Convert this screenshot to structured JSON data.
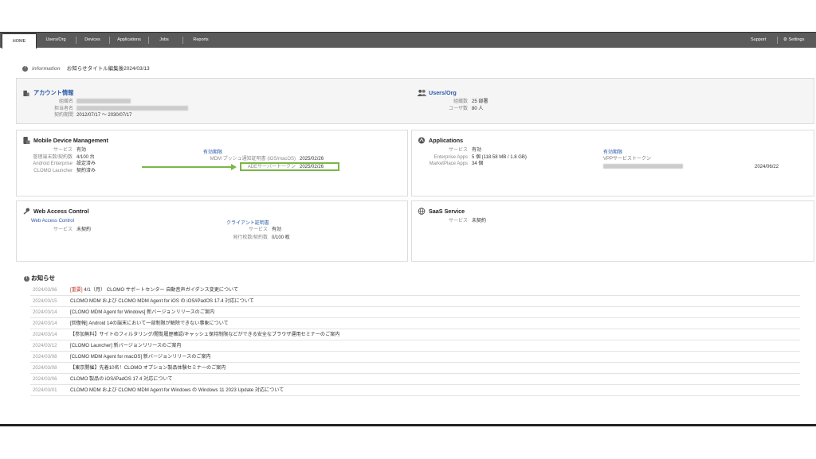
{
  "nav": {
    "tabs": [
      "HOME",
      "Users/Org",
      "Devices",
      "Applications",
      "Jobs",
      "Reports"
    ],
    "active": "HOME",
    "support": "Support",
    "settings": "Settings"
  },
  "info": {
    "title": "information",
    "text": "お知らせタイトル編集後2024/03/13"
  },
  "account": {
    "title": "アカウント情報",
    "labels": [
      "組織名",
      "担当者名",
      "契約期間"
    ],
    "period": "2012/07/17 〜 2030/07/17"
  },
  "users_org": {
    "title": "Users/Org",
    "labels": [
      "組織数",
      "ユーザ数"
    ],
    "values": [
      "25 部署",
      "80 人"
    ]
  },
  "mdm": {
    "title": "Mobile Device Management",
    "labels": [
      "サービス",
      "管理端末数/契約数",
      "Android Enterprise",
      "CLOMO Launcher"
    ],
    "values": [
      "有効",
      "4/100 台",
      "設定済み",
      "契約済み"
    ],
    "expiry_title": "有効期限",
    "cert_label": "MDM プッシュ通知証明書 (iOS/macOS)",
    "cert_date": "2025/02/26",
    "ade_label": "ADEサーバートークン",
    "ade_date": "2025/02/26"
  },
  "apps": {
    "title": "Applications",
    "labels": [
      "サービス",
      "Enterprise Apps",
      "MarketPlace Apps"
    ],
    "values": [
      "有効",
      "5 個 (118.58 MB / 1.8 GB)",
      "34 個"
    ],
    "expiry_title": "有効期限",
    "vpp_label": "VPPサービストークン",
    "vpp_date": "2024/06/22"
  },
  "wac": {
    "title": "Web Access Control",
    "link": "Web Access Control",
    "labels": [
      "サービス"
    ],
    "values": [
      "未契約"
    ],
    "cert_title": "クライアント証明書",
    "cert_labels": [
      "サービス",
      "発行枚数/契約数"
    ],
    "cert_values": [
      "有効",
      "0/100 枚"
    ]
  },
  "saas": {
    "title": "SaaS Service",
    "labels": [
      "サービス"
    ],
    "values": [
      "未契約"
    ]
  },
  "news": {
    "title": "お知らせ",
    "items": [
      {
        "date": "2024/03/06",
        "tag": "[重要]",
        "text": "4/1（月） CLOMO サポートセンター 自動音声ガイダンス変更について"
      },
      {
        "date": "2024/03/15",
        "tag": "",
        "text": "CLOMO MDM および CLOMO MDM Agent for iOS の iOS/iPadOS 17.4 対応について"
      },
      {
        "date": "2024/03/14",
        "tag": "",
        "text": "[CLOMO MDM Agent for Windows] 新バージョンリリースのご案内"
      },
      {
        "date": "2024/03/14",
        "tag": "",
        "text": "[回復報] Android 14の端末において一部制限が解除できない事象について"
      },
      {
        "date": "2024/03/14",
        "tag": "",
        "text": "【参加無料】サイトのフィルタリング/閲覧履歴確認/キャッシュ保持制限などができる安全なブラウザ運用セミナーのご案内"
      },
      {
        "date": "2024/03/12",
        "tag": "",
        "text": "[CLOMO Launcher] 新バージョンリリースのご案内"
      },
      {
        "date": "2024/03/08",
        "tag": "",
        "text": "[CLOMO MDM Agent for macOS] 新バージョンリリースのご案内"
      },
      {
        "date": "2024/03/08",
        "tag": "",
        "text": "【東京開催】先着10名！CLOMO オプション製品体験セミナーのご案内"
      },
      {
        "date": "2024/03/06",
        "tag": "",
        "text": "CLOMO 製品の iOS/iPadOS 17.4 対応について"
      },
      {
        "date": "2024/03/01",
        "tag": "",
        "text": "CLOMO MDM および CLOMO MDM Agent for Windows の Windows 11 2023 Update 対応について"
      }
    ]
  },
  "colors": {
    "accent": "#2a5aa8",
    "highlight": "#7ab648",
    "nav": "#5a5a5a",
    "tag": "#c0392b"
  }
}
